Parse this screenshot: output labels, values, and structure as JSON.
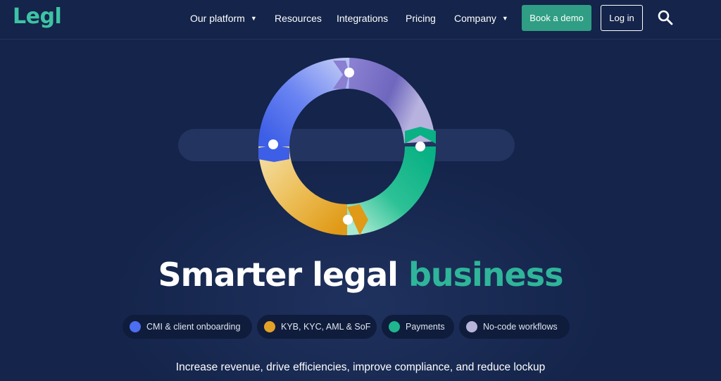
{
  "brand": {
    "logo_text": "Legl",
    "logo_color": "#3ec3a4"
  },
  "nav": {
    "items": [
      {
        "label": "Our platform",
        "has_dropdown": true
      },
      {
        "label": "Resources",
        "has_dropdown": false
      },
      {
        "label": "Integrations",
        "has_dropdown": false
      },
      {
        "label": "Pricing",
        "has_dropdown": false
      },
      {
        "label": "Company",
        "has_dropdown": true
      }
    ],
    "book_demo_label": "Book a demo",
    "login_label": "Log in",
    "search_icon": "search-icon"
  },
  "hero": {
    "headline_main": "Smarter legal ",
    "headline_accent": "business",
    "tags": [
      {
        "label": "CMI & client onboarding",
        "color": "#4d6ef0"
      },
      {
        "label": "KYB, KYC, AML & SoF",
        "color": "#e2a227"
      },
      {
        "label": "Payments",
        "color": "#1fb58e"
      },
      {
        "label": "No-code workflows",
        "color": "#b6b4d8"
      }
    ],
    "subline": "Increase revenue, drive efficiencies, improve compliance, and reduce lockup"
  },
  "colors": {
    "background": "#14244a",
    "accent_green": "#2fb59a",
    "button_green": "#2f9e84"
  }
}
